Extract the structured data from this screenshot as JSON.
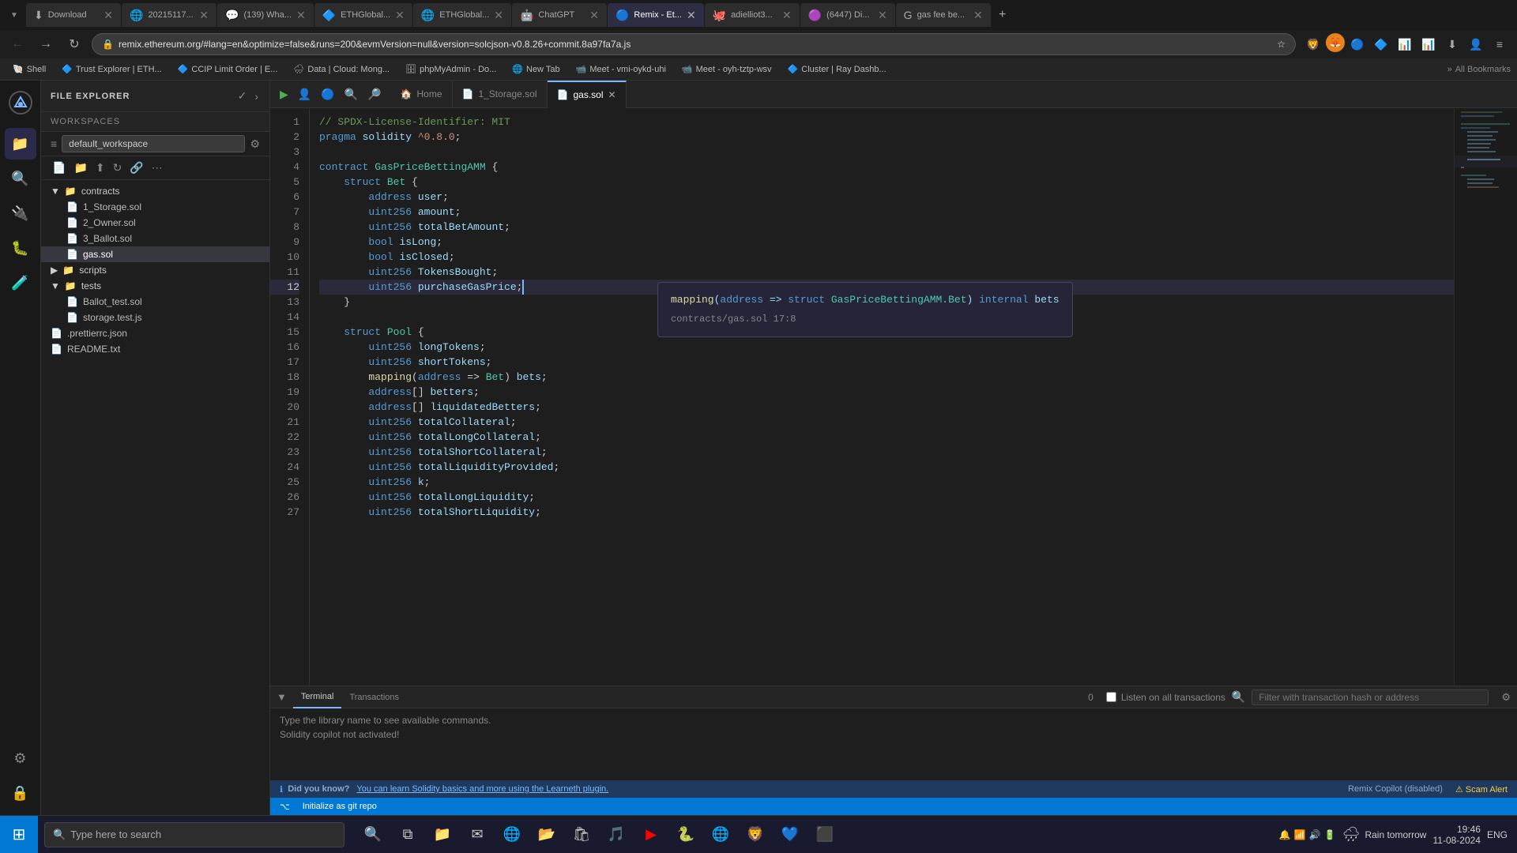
{
  "browser": {
    "tabs": [
      {
        "id": 1,
        "favicon": "⬇",
        "title": "Download",
        "active": false,
        "closeable": true
      },
      {
        "id": 2,
        "favicon": "🌐",
        "title": "20215117...",
        "active": false,
        "closeable": true
      },
      {
        "id": 3,
        "favicon": "💜",
        "title": "(139) Wha...",
        "active": false,
        "closeable": true
      },
      {
        "id": 4,
        "favicon": "🔷",
        "title": "ETHGlobal...",
        "active": false,
        "closeable": true
      },
      {
        "id": 5,
        "favicon": "🌐",
        "title": "ETHGlobal...",
        "active": false,
        "closeable": true
      },
      {
        "id": 6,
        "favicon": "🤖",
        "title": "ChatGPT",
        "active": false,
        "closeable": true
      },
      {
        "id": 7,
        "favicon": "🔵",
        "title": "Remix - Et...",
        "active": true,
        "closeable": true
      },
      {
        "id": 8,
        "favicon": "🐙",
        "title": "adielliot3...",
        "active": false,
        "closeable": true
      },
      {
        "id": 9,
        "favicon": "🟣",
        "title": "(6447) Di...",
        "active": false,
        "closeable": true
      },
      {
        "id": 10,
        "favicon": "G",
        "title": "gas fee be...",
        "active": false,
        "closeable": true
      }
    ],
    "url": "remix.ethereum.org/#lang=en&optimize=false&runs=200&evmVersion=null&version=solcjson-v0.8.26+commit.8a97fa7a.js",
    "bookmarks": [
      {
        "icon": "🐚",
        "title": "Shell"
      },
      {
        "icon": "🔷",
        "title": "Trust Explorer | ETH..."
      },
      {
        "icon": "🔷",
        "title": "CCIP Limit Order | E..."
      },
      {
        "icon": "🌧",
        "title": "Data | Cloud: Mong..."
      },
      {
        "icon": "🗄",
        "title": "phpMyAdmin - Do..."
      },
      {
        "icon": "🌐",
        "title": "New Tab"
      },
      {
        "icon": "📹",
        "title": "Meet - vmi-oykd-uhi"
      },
      {
        "icon": "📹",
        "title": "Meet - oyh-tztp-wsv"
      },
      {
        "icon": "🔷",
        "title": "Cluster | Ray Dashb..."
      }
    ]
  },
  "remix": {
    "sidebar_icons": [
      "🏠",
      "📁",
      "🔍",
      "🔌",
      "🐛",
      "🧪",
      "⚙",
      "🔒"
    ],
    "panel_title": "FILE EXPLORER",
    "workspaces_label": "WORKSPACES",
    "workspace_name": "default_workspace",
    "file_actions": [
      "📄+",
      "📁+",
      "⬆",
      "↻",
      "🔗",
      "⋯"
    ],
    "file_tree": {
      "contracts_folder": "contracts",
      "files": [
        {
          "name": "1_Storage.sol",
          "icon": "📄",
          "active": false
        },
        {
          "name": "2_Owner.sol",
          "icon": "📄",
          "active": false
        },
        {
          "name": "3_Ballot.sol",
          "icon": "📄",
          "active": false
        },
        {
          "name": "gas.sol",
          "icon": "📄",
          "active": true
        }
      ],
      "scripts_folder": "scripts",
      "tests_folder": "tests",
      "test_files": [
        {
          "name": "Ballot_test.sol",
          "icon": "📄",
          "active": false
        },
        {
          "name": "storage.test.js",
          "icon": "📄",
          "active": false
        }
      ],
      "other_files": [
        {
          "name": ".prettierrc.json",
          "icon": "📄",
          "active": false
        },
        {
          "name": "README.txt",
          "icon": "📄",
          "active": false
        }
      ]
    }
  },
  "editor": {
    "tabs": [
      {
        "name": "Home",
        "icon": "🏠",
        "active": false,
        "closeable": false
      },
      {
        "name": "1_Storage.sol",
        "icon": "📄",
        "active": false,
        "closeable": false
      },
      {
        "name": "gas.sol",
        "icon": "📄",
        "active": true,
        "closeable": true
      }
    ],
    "code_lines": [
      {
        "num": 1,
        "text": "// SPDX-License-Identifier: MIT"
      },
      {
        "num": 2,
        "text": "pragma solidity ^0.8.0;"
      },
      {
        "num": 3,
        "text": ""
      },
      {
        "num": 4,
        "text": "contract GasPriceBettingAMM {"
      },
      {
        "num": 5,
        "text": "    struct Bet {"
      },
      {
        "num": 6,
        "text": "        address user;"
      },
      {
        "num": 7,
        "text": "        uint256 amount;"
      },
      {
        "num": 8,
        "text": "        uint256 totalBetAmount;"
      },
      {
        "num": 9,
        "text": "        bool isLong;"
      },
      {
        "num": 10,
        "text": "        bool isClosed;"
      },
      {
        "num": 11,
        "text": "        uint256 TokensBought;"
      },
      {
        "num": 12,
        "text": "        uint256 purchaseGasPrice;"
      },
      {
        "num": 13,
        "text": "    }"
      },
      {
        "num": 14,
        "text": ""
      },
      {
        "num": 15,
        "text": "    struct Pool {"
      },
      {
        "num": 16,
        "text": "        uint256 longTokens;"
      },
      {
        "num": 17,
        "text": "        uint256 shortTokens;"
      },
      {
        "num": 18,
        "text": "        mapping(address => Bet) bets;"
      },
      {
        "num": 19,
        "text": "        address[] betters;"
      },
      {
        "num": 20,
        "text": "        address[] liquidatedBetters;"
      },
      {
        "num": 21,
        "text": "        uint256 totalCollateral;"
      },
      {
        "num": 22,
        "text": "        uint256 totalLongCollateral;"
      },
      {
        "num": 23,
        "text": "        uint256 totalShortCollateral;"
      },
      {
        "num": 24,
        "text": "        uint256 totalLiquidityProvided;"
      },
      {
        "num": 25,
        "text": "        uint256 k;"
      },
      {
        "num": 26,
        "text": "        uint256 totalLongLiquidity;"
      },
      {
        "num": 27,
        "text": "        uint256 totalShortLiquidity;"
      }
    ],
    "tooltip": {
      "line1": "mapping(address => struct GasPriceBettingAMM.Bet) internal bets",
      "line2": "contracts/gas.sol 17:8"
    }
  },
  "bottom_panel": {
    "tabs": [
      "Terminal",
      "Transactions"
    ],
    "active_tab": "Terminal",
    "count": "0",
    "listen_label": "Listen on all transactions",
    "filter_placeholder": "Filter with transaction hash or address",
    "terminal_text1": "Type the library name to see available commands.",
    "terminal_text2": "Solidity copilot not activated!"
  },
  "status_bar": {
    "git_label": "Initialize as git repo",
    "tip_text": "Did you know?",
    "tip_link": "You can learn Solidity basics and more using the Learneth plugin.",
    "copilot_label": "Remix Copilot (disabled)",
    "scam_label": "⚠ Scam Alert"
  },
  "taskbar": {
    "search_placeholder": "Type here to search",
    "weather_label": "Rain tomorrow",
    "time": "19:46",
    "date": "11-08-2024",
    "lang": "ENG"
  }
}
